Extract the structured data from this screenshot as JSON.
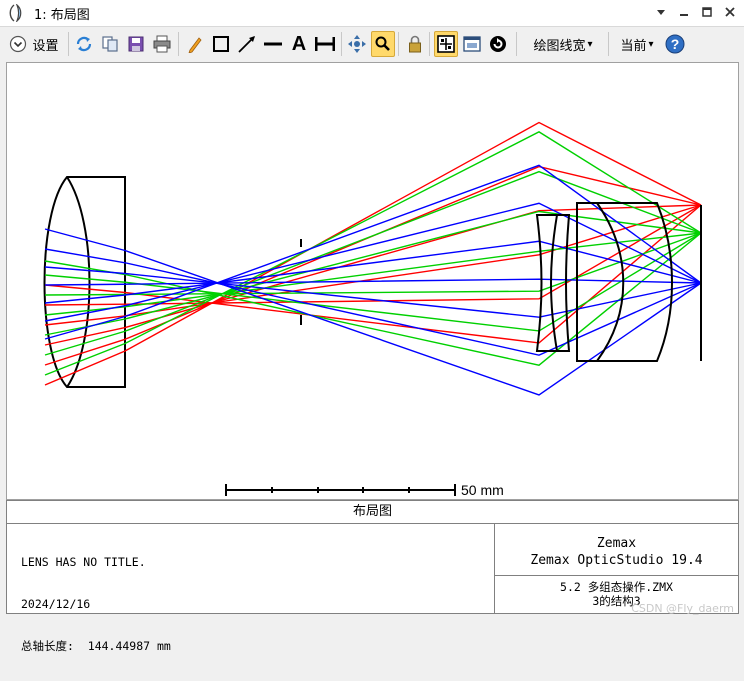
{
  "window": {
    "title": "1: 布局图",
    "controls": [
      "chevron-down-icon",
      "minimize-icon",
      "maximize-icon",
      "close-icon"
    ]
  },
  "toolbar": {
    "settings_label": "设置",
    "line_width_label": "绘图线宽",
    "current_label": "当前",
    "dropdown_arrow": "▾",
    "text_tool_glyph": "A",
    "active_tools": [
      "zoom-icon",
      "grid-frame-icon"
    ]
  },
  "layout": {
    "scale_bar_label": "50 mm",
    "ray_colors": [
      "#ff0000",
      "#00d000",
      "#0000ff"
    ]
  },
  "label_box": {
    "header": "布局图",
    "lines_left": [
      "LENS HAS NO TITLE.",
      "2024/12/16",
      "总轴长度:  144.44987 mm"
    ],
    "company": "Zemax",
    "product": "Zemax OpticStudio 19.4",
    "file": "5.2 多组态操作.ZMX",
    "config": "3的结构3"
  },
  "watermark": "CSDN @Fly_daerm"
}
